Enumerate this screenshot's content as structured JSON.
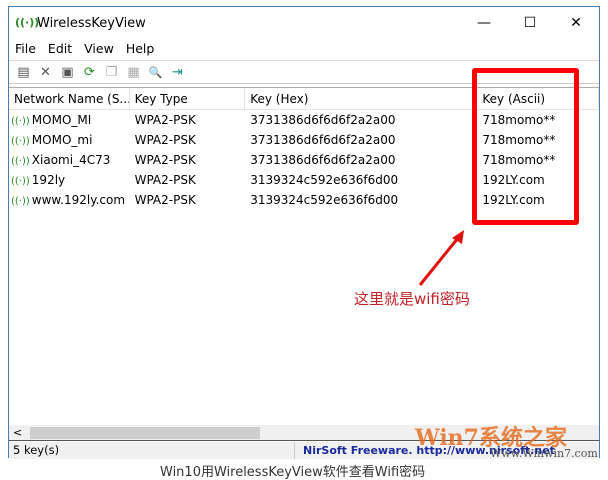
{
  "window": {
    "title": "WirelessKeyView",
    "minimize": "—",
    "maximize": "☐",
    "close": "✕"
  },
  "menu": [
    "File",
    "Edit",
    "View",
    "Help"
  ],
  "toolbar": [
    {
      "icon": "properties-icon",
      "glyph": "▤"
    },
    {
      "icon": "delete-icon",
      "glyph": "✕"
    },
    {
      "icon": "save-icon",
      "glyph": "▣"
    },
    {
      "icon": "refresh-icon",
      "glyph": "⟳"
    },
    {
      "icon": "copy-icon",
      "glyph": "❐"
    },
    {
      "icon": "paste-icon",
      "glyph": "▦"
    },
    {
      "icon": "find-icon",
      "glyph": "🔍"
    },
    {
      "icon": "exit-icon",
      "glyph": "⇥"
    }
  ],
  "columns": [
    "Network Name (S...",
    "Key Type",
    "Key (Hex)",
    "Key (Ascii)"
  ],
  "rows": [
    [
      "MOMO_MI",
      "WPA2-PSK",
      "3731386d6f6d6f2a2a00",
      "718momo**"
    ],
    [
      "MOMO_mi",
      "WPA2-PSK",
      "3731386d6f6d6f2a2a00",
      "718momo**"
    ],
    [
      "Xiaomi_4C73",
      "WPA2-PSK",
      "3731386d6f6d6f2a2a00",
      "718momo**"
    ],
    [
      "192ly",
      "WPA2-PSK",
      "3139324c592e636f6d00",
      "192LY.com"
    ],
    [
      "www.192ly.com",
      "WPA2-PSK",
      "3139324c592e636f6d00",
      "192LY.com"
    ]
  ],
  "status": {
    "count": "5 key(s)",
    "link": "NirSoft Freeware.  http://www.nirsoft.net"
  },
  "annotation": "这里就是wifi密码",
  "caption": "Win10用WirelessKeyView软件查看Wifi密码",
  "watermark": {
    "brand": "Win7系统之家",
    "url": "Www.Winwin7.com"
  }
}
